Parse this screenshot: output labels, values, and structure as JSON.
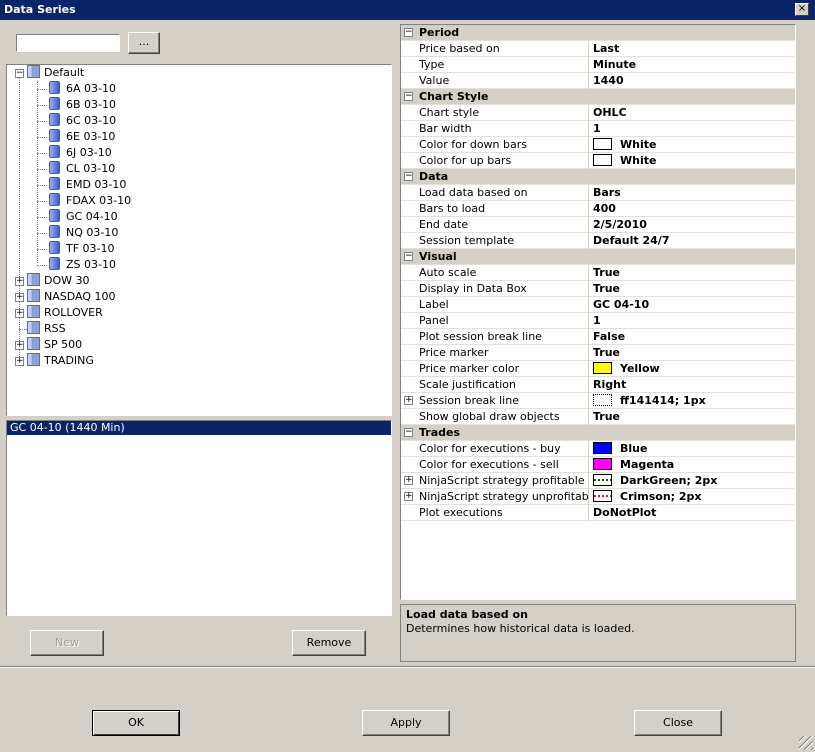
{
  "window": {
    "title": "Data Series",
    "close_glyph": "×"
  },
  "search": {
    "value": "",
    "browse_label": "..."
  },
  "tree": {
    "default_label": "Default",
    "instruments": [
      "6A 03-10",
      "6B 03-10",
      "6C 03-10",
      "6E 03-10",
      "6J 03-10",
      "CL 03-10",
      "EMD 03-10",
      "FDAX 03-10",
      "GC 04-10",
      "NQ 03-10",
      "TF 03-10",
      "ZS 03-10"
    ],
    "lists": [
      {
        "label": "DOW 30",
        "expandable": true
      },
      {
        "label": "NASDAQ 100",
        "expandable": true
      },
      {
        "label": "ROLLOVER",
        "expandable": true
      },
      {
        "label": "RSS",
        "expandable": false
      },
      {
        "label": "SP 500",
        "expandable": true
      },
      {
        "label": "TRADING",
        "expandable": true
      }
    ]
  },
  "selected_series": "GC 04-10 (1440 Min)",
  "buttons": {
    "new": "New",
    "remove": "Remove",
    "ok": "OK",
    "apply": "Apply",
    "close": "Close"
  },
  "properties": {
    "period_title": "Period",
    "price_based_on": {
      "label": "Price based on",
      "value": "Last"
    },
    "type": {
      "label": "Type",
      "value": "Minute"
    },
    "value": {
      "label": "Value",
      "value": "1440"
    },
    "chartstyle_title": "Chart Style",
    "chart_style": {
      "label": "Chart style",
      "value": "OHLC"
    },
    "bar_width": {
      "label": "Bar width",
      "value": "1"
    },
    "color_down": {
      "label": "Color for down bars",
      "value": "White",
      "color": "#ffffff"
    },
    "color_up": {
      "label": "Color for up bars",
      "value": "White",
      "color": "#ffffff"
    },
    "data_title": "Data",
    "load_based_on": {
      "label": "Load data based on",
      "value": "Bars"
    },
    "bars_to_load": {
      "label": "Bars to load",
      "value": "400"
    },
    "end_date": {
      "label": "End date",
      "value": "2/5/2010"
    },
    "session_template": {
      "label": "Session template",
      "value": "Default 24/7"
    },
    "visual_title": "Visual",
    "auto_scale": {
      "label": "Auto scale",
      "value": "True"
    },
    "display_databox": {
      "label": "Display in Data Box",
      "value": "True"
    },
    "label": {
      "label": "Label",
      "value": "GC 04-10"
    },
    "panel": {
      "label": "Panel",
      "value": "1"
    },
    "plot_session_break": {
      "label": "Plot session break line",
      "value": "False"
    },
    "price_marker": {
      "label": "Price marker",
      "value": "True"
    },
    "price_marker_color": {
      "label": "Price marker color",
      "value": "Yellow",
      "color": "#ffff00"
    },
    "scale_justification": {
      "label": "Scale justification",
      "value": "Right"
    },
    "session_break_line": {
      "label": "Session break line",
      "value": "ff141414; 1px",
      "color": "#141414"
    },
    "show_global_draw": {
      "label": "Show global draw objects",
      "value": "True"
    },
    "trades_title": "Trades",
    "exec_buy": {
      "label": "Color for executions - buy",
      "value": "Blue",
      "color": "#0000ff"
    },
    "exec_sell": {
      "label": "Color for executions - sell",
      "value": "Magenta",
      "color": "#ff00ff"
    },
    "ns_profitable": {
      "label": "NinjaScript strategy profitable trade",
      "value": "DarkGreen; 2px",
      "color": "#006400"
    },
    "ns_unprofitable": {
      "label": "NinjaScript strategy unprofitable trac",
      "value": "Crimson; 2px",
      "color": "#dc143c"
    },
    "plot_executions": {
      "label": "Plot executions",
      "value": "DoNotPlot"
    }
  },
  "description": {
    "title": "Load data based on",
    "text": "Determines how historical data is loaded."
  }
}
